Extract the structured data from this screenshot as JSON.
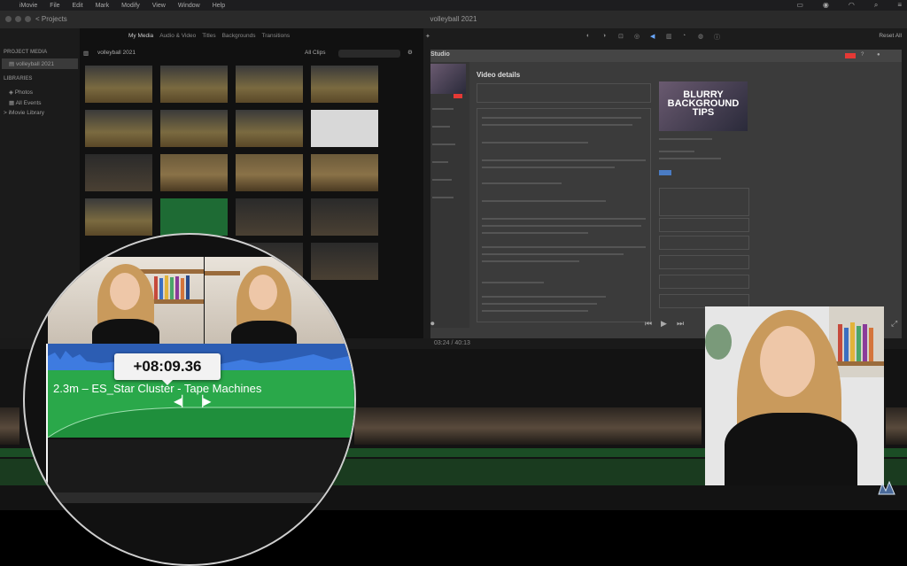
{
  "menubar": {
    "items": [
      "iMovie",
      "File",
      "Edit",
      "Mark",
      "Modify",
      "View",
      "Window",
      "Help"
    ]
  },
  "window": {
    "projects_label": "< Projects",
    "title": "volleyball 2021"
  },
  "sidebar": {
    "project_media_header": "PROJECT MEDIA",
    "project_item": "volleyball 2021",
    "libraries_header": "LIBRARIES",
    "library_items": [
      "Photos",
      "All Events",
      "> iMovie Library"
    ]
  },
  "browser": {
    "tabs": [
      "My Media",
      "Audio & Video",
      "Titles",
      "Backgrounds",
      "Transitions"
    ],
    "header_title": "volleyball 2021",
    "filter_label": "All Clips"
  },
  "viewer": {
    "reset_all": "Reset All",
    "studio_label": "Studio",
    "details_heading": "Video details",
    "thumb_title": "BLURRY BACKGROUND TIPS",
    "timecode": "03:24  /  40:13"
  },
  "clip": {
    "timecode_tooltip": "+08:09.36",
    "audio_clip_label": "2.3m – ES_Star Cluster - Tape Machines"
  },
  "colors": {
    "audio_blue": "#2c5db3",
    "audio_green": "#2aa84a",
    "accent_red": "#e53935"
  }
}
